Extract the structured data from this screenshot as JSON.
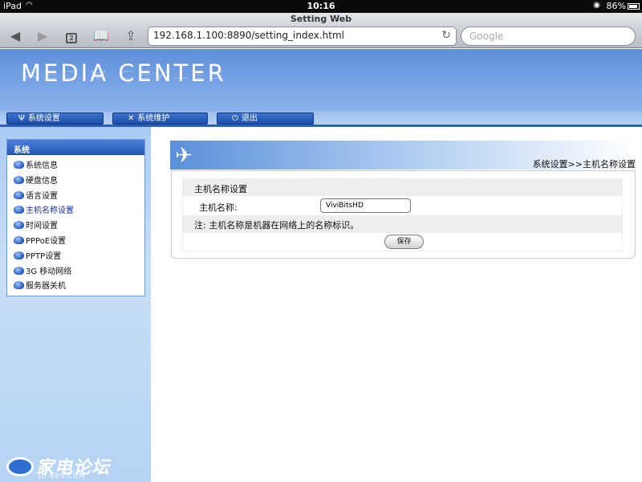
{
  "status_bar": {
    "device": "iPad",
    "time": "10:16",
    "battery": "86%"
  },
  "browser": {
    "page_title": "Setting Web",
    "url": "192.168.1.100:8890/setting_index.html",
    "search_placeholder": "Google",
    "tab_count": "2"
  },
  "header": {
    "logo_text": "MEDIA CENTER"
  },
  "top_nav": [
    {
      "label": "系统设置"
    },
    {
      "label": "系统维护"
    },
    {
      "label": "退出"
    }
  ],
  "sidebar": {
    "title": "系统",
    "items": [
      {
        "label": "系统信息"
      },
      {
        "label": "硬盘信息"
      },
      {
        "label": "语言设置"
      },
      {
        "label": "主机名称设置",
        "active": true
      },
      {
        "label": "时间设置"
      },
      {
        "label": "PPPoE设置"
      },
      {
        "label": "PPTP设置"
      },
      {
        "label": "3G 移动网络"
      },
      {
        "label": "服务器关机"
      }
    ]
  },
  "main": {
    "breadcrumb": "系统设置>>主机名称设置",
    "panel_title": "主机名称设置",
    "hostname_label": "主机名称:",
    "hostname_value": "ViviBitsHD",
    "note": "注: 主机名称是机器在网络上的名称标识。",
    "save_label": "保存"
  },
  "watermark": {
    "name": "家电论坛",
    "site": "JD-BBS.COM"
  },
  "colors": {
    "banner_blue": "#6f9ee0",
    "nav_button": "#2a5fbd",
    "sidebar_bg": "#b9d6f6"
  }
}
